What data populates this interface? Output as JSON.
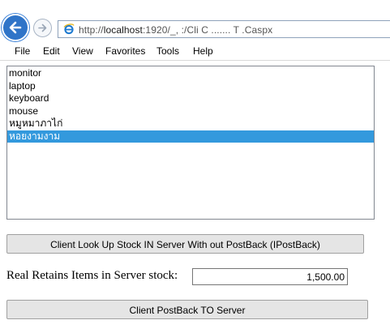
{
  "browser": {
    "url_prefix": "http://",
    "url_host": "localhost",
    "url_rest": ":1920/_, :/Cli   C       .......        T   .Caspx"
  },
  "menu": {
    "items": [
      "File",
      "Edit",
      "View",
      "Favorites",
      "Tools",
      "Help"
    ]
  },
  "page": {
    "stock_list": {
      "items": [
        "monitor",
        "laptop",
        "keyboard",
        "mouse",
        "หมูหมาภาไก่",
        "หอยงามงาม"
      ],
      "selected_index": 5
    },
    "lookup_button_label": "Client Look Up Stock IN Server With out PostBack (IPostBack)",
    "stock_label": "Real Retains Items in Server stock:",
    "stock_value": "1,500.00",
    "postback_button_label": "Client PostBack TO Server"
  },
  "colors": {
    "selection": "#3399dd",
    "back_button": "#2f74c8"
  },
  "icons": {
    "back": "back-arrow-icon",
    "forward": "forward-arrow-icon",
    "page": "ie-page-icon"
  }
}
